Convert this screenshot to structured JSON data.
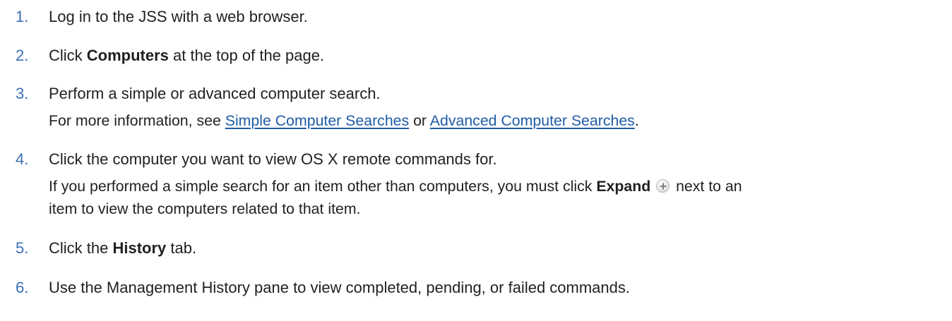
{
  "steps": [
    {
      "number": "1.",
      "text": "Log in to the JSS with a web browser."
    },
    {
      "number": "2.",
      "pre": "Click ",
      "bold": "Computers",
      "post": " at the top of the page."
    },
    {
      "number": "3.",
      "text": "Perform a simple or advanced computer search.",
      "note": {
        "pre": "For more information, see ",
        "link1": "Simple Computer Searches",
        "mid": " or ",
        "link2": "Advanced Computer Searches",
        "post": "."
      }
    },
    {
      "number": "4.",
      "text": "Click the computer you want to view OS X remote commands for.",
      "note": {
        "pre": "If you performed a simple search for an item other than computers, you must click ",
        "bold": "Expand",
        "icon": "plus-circle-icon",
        "post": " next to an",
        "line2": "item to view the computers related to that item."
      }
    },
    {
      "number": "5.",
      "pre": "Click the ",
      "bold": "History",
      "post": " tab."
    },
    {
      "number": "6.",
      "text": "Use the Management History pane to view completed, pending, or failed commands."
    }
  ]
}
